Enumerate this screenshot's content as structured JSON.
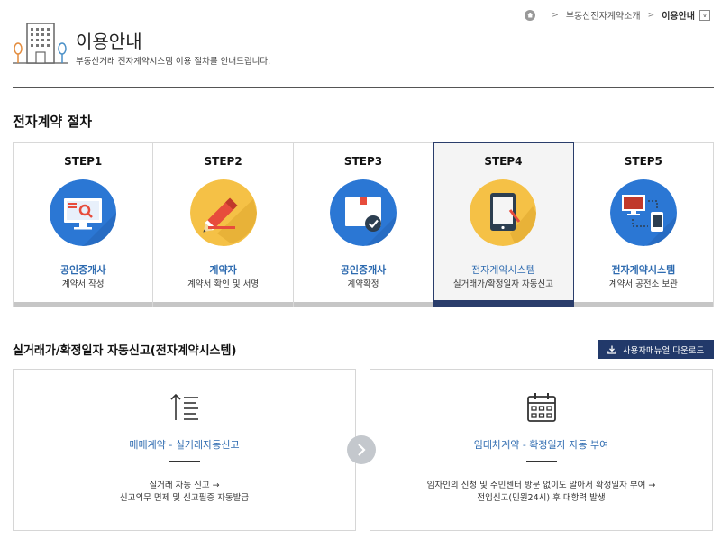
{
  "breadcrumb": {
    "parent": "부동산전자계약소개",
    "current": "이용안내",
    "dropdown": "v",
    "separator": ">"
  },
  "header": {
    "title": "이용안내",
    "description": "부동산거래 전자계약시스템 이용 절차를 안내드립니다."
  },
  "section1": {
    "title": "전자계약 절차",
    "steps": [
      {
        "num": "STEP1",
        "role": "공인중개사",
        "desc": "계약서 작성",
        "color": "#2b77d4",
        "icon": "monitor-search-icon"
      },
      {
        "num": "STEP2",
        "role": "계약자",
        "desc": "계약서 확인 및 서명",
        "color": "#f5c146",
        "icon": "pencil-icon"
      },
      {
        "num": "STEP3",
        "role": "공인중개사",
        "desc": "계약확정",
        "color": "#2b77d4",
        "icon": "document-check-icon"
      },
      {
        "num": "STEP4",
        "role": "전자계약시스템",
        "desc": "실거래가/확정일자 자동신고",
        "color": "#f5c146",
        "icon": "tablet-icon",
        "active": true
      },
      {
        "num": "STEP5",
        "role": "전자계약시스템",
        "desc": "계약서 공전소 보관",
        "color": "#2b77d4",
        "icon": "devices-icon"
      }
    ]
  },
  "section2": {
    "title": "실거래가/확정일자 자동신고(전자계약시스템)",
    "download_label": "사용자매뉴얼 다운로드",
    "cards": [
      {
        "title": "매매계약 - 실거래자동신고",
        "line1": "실거래 자동 신고 →",
        "line2": "신고의무 면제 및 신고필증 자동발급",
        "icon": "sort-list-icon"
      },
      {
        "title": "임대차계약 - 확정일자 자동 부여",
        "line1": "임차인의 신청 및 주민센터 방문 없이도 알아서 확정일자 부여 →",
        "line2": "전입신고(민원24시) 후 대항력 발생",
        "icon": "calendar-icon"
      }
    ]
  },
  "colors": {
    "navy": "#22396a",
    "link_blue": "#2e6bb0",
    "step_blue": "#2b77d4",
    "step_yellow": "#f5c146"
  }
}
